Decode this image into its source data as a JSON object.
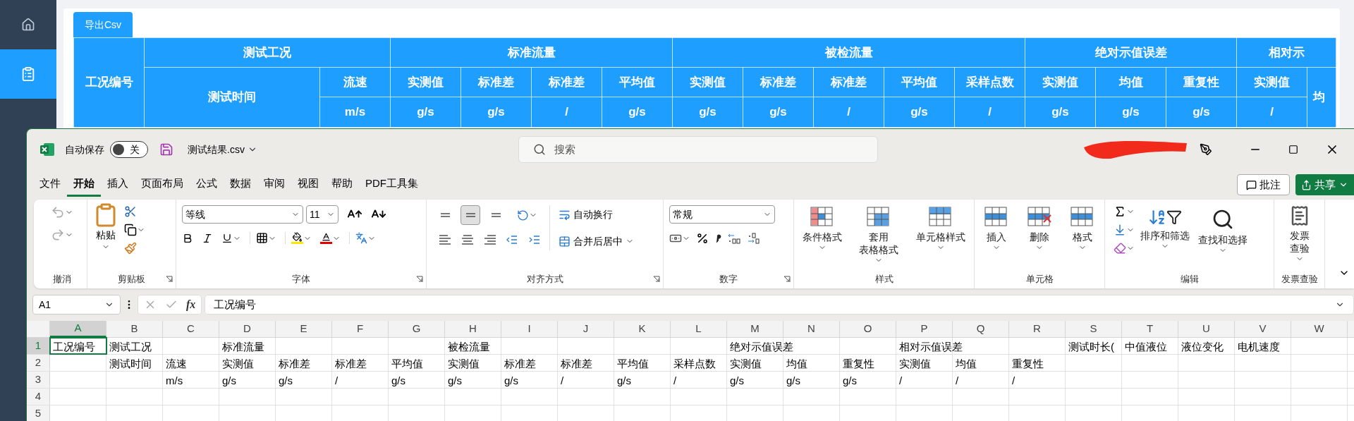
{
  "web": {
    "sidebar": {
      "items": [
        {
          "kind": "home",
          "selected": false
        },
        {
          "kind": "clipboard",
          "selected": true
        }
      ]
    },
    "export_button": "导出Csv",
    "table": {
      "id_header": "工况编号",
      "groups": [
        {
          "title": "测试工况",
          "columns": [
            {
              "label": "测试时间"
            },
            {
              "label": "流速",
              "unit": "m/s"
            }
          ]
        },
        {
          "title": "标准流量",
          "columns": [
            {
              "label": "实测值",
              "unit": "g/s"
            },
            {
              "label": "标准差",
              "unit": "g/s"
            },
            {
              "label": "标准差",
              "unit": "/"
            },
            {
              "label": "平均值",
              "unit": "g/s"
            }
          ]
        },
        {
          "title": "被检流量",
          "columns": [
            {
              "label": "实测值",
              "unit": "g/s"
            },
            {
              "label": "标准差",
              "unit": "g/s"
            },
            {
              "label": "标准差",
              "unit": "/"
            },
            {
              "label": "平均值",
              "unit": "g/s"
            },
            {
              "label": "采样点数",
              "unit": "/"
            }
          ]
        },
        {
          "title": "绝对示值误差",
          "columns": [
            {
              "label": "实测值",
              "unit": "g/s"
            },
            {
              "label": "均值",
              "unit": "g/s"
            },
            {
              "label": "重复性",
              "unit": "g/s"
            }
          ]
        },
        {
          "title": "相对示",
          "columns": [
            {
              "label": "实测值",
              "unit": "/"
            },
            {
              "label": "均"
            }
          ]
        }
      ]
    }
  },
  "excel": {
    "title_bar": {
      "autosave_label": "自动保存",
      "autosave": {
        "on": false,
        "label": "关"
      },
      "file_name": "测试结果.csv",
      "search_placeholder": "搜索"
    },
    "tabs": [
      {
        "label": "文件",
        "selected": false
      },
      {
        "label": "开始",
        "selected": true
      },
      {
        "label": "插入",
        "selected": false
      },
      {
        "label": "页面布局",
        "selected": false
      },
      {
        "label": "公式",
        "selected": false
      },
      {
        "label": "数据",
        "selected": false
      },
      {
        "label": "审阅",
        "selected": false
      },
      {
        "label": "视图",
        "selected": false
      },
      {
        "label": "帮助",
        "selected": false
      },
      {
        "label": "PDF工具集",
        "selected": false
      }
    ],
    "comments_button": "批注",
    "share_button": "共享",
    "ribbon": {
      "groups": [
        {
          "kind": "undo",
          "label": "撤消"
        },
        {
          "kind": "clipboard",
          "label": "剪贴板",
          "paste": "粘贴"
        },
        {
          "kind": "font",
          "label": "字体",
          "font_name": "等线",
          "font_size": "11"
        },
        {
          "kind": "alignment",
          "label": "对齐方式",
          "valign_buttons": [
            {
              "selected": false
            },
            {
              "selected": true
            },
            {
              "selected": false
            }
          ],
          "wrap": "自动换行",
          "merge": "合并后居中"
        },
        {
          "kind": "number",
          "label": "数字",
          "format": "常规"
        },
        {
          "kind": "styles",
          "label": "样式",
          "buttons": [
            {
              "lines": [
                "条件格式"
              ]
            },
            {
              "lines": [
                "套用",
                "表格格式"
              ]
            },
            {
              "lines": [
                "单元格样式"
              ]
            }
          ]
        },
        {
          "kind": "cells",
          "label": "单元格",
          "buttons": [
            {
              "lines": [
                "插入"
              ]
            },
            {
              "lines": [
                "删除"
              ]
            },
            {
              "lines": [
                "格式"
              ]
            }
          ]
        },
        {
          "kind": "editing",
          "label": "编辑",
          "buttons": [
            {
              "lines": [
                "排序和筛选"
              ]
            },
            {
              "lines": [
                "查找和选择"
              ]
            }
          ]
        },
        {
          "kind": "invoice",
          "label": "发票查验",
          "buttons": [
            {
              "lines": [
                "发票",
                "查验"
              ]
            }
          ]
        }
      ]
    },
    "formula_bar": {
      "name_box": "A1",
      "fx": "fx",
      "value": "工况编号"
    },
    "sheet": {
      "columns": [
        {
          "letter": "A",
          "selected": true
        },
        {
          "letter": "B",
          "selected": false
        },
        {
          "letter": "C",
          "selected": false
        },
        {
          "letter": "D",
          "selected": false
        },
        {
          "letter": "E",
          "selected": false
        },
        {
          "letter": "F",
          "selected": false
        },
        {
          "letter": "G",
          "selected": false
        },
        {
          "letter": "H",
          "selected": false
        },
        {
          "letter": "I",
          "selected": false
        },
        {
          "letter": "J",
          "selected": false
        },
        {
          "letter": "K",
          "selected": false
        },
        {
          "letter": "L",
          "selected": false
        },
        {
          "letter": "M",
          "selected": false
        },
        {
          "letter": "N",
          "selected": false
        },
        {
          "letter": "O",
          "selected": false
        },
        {
          "letter": "P",
          "selected": false
        },
        {
          "letter": "Q",
          "selected": false
        },
        {
          "letter": "R",
          "selected": false
        },
        {
          "letter": "S",
          "selected": false
        },
        {
          "letter": "T",
          "selected": false
        },
        {
          "letter": "U",
          "selected": false
        },
        {
          "letter": "V",
          "selected": false
        },
        {
          "letter": "W",
          "selected": false
        }
      ],
      "rows": [
        {
          "number": "1",
          "selected": true,
          "cells": [
            "工况编号",
            "测试工况",
            null,
            "标准流量",
            null,
            null,
            null,
            "被检流量",
            null,
            null,
            null,
            null,
            "绝对示值误差",
            null,
            null,
            "相对示值误差",
            null,
            null,
            "测试时长(",
            "中值液位",
            "液位变化",
            "电机速度",
            null
          ]
        },
        {
          "number": "2",
          "selected": false,
          "cells": [
            null,
            "测试时间",
            "流速",
            "实测值",
            "标准差",
            "标准差",
            "平均值",
            "实测值",
            "标准差",
            "标准差",
            "平均值",
            "采样点数",
            "实测值",
            "均值",
            "重复性",
            "实测值",
            "均值",
            "重复性",
            null,
            null,
            null,
            null,
            null
          ]
        },
        {
          "number": "3",
          "selected": false,
          "cells": [
            null,
            null,
            "m/s",
            "g/s",
            "g/s",
            "/",
            "g/s",
            "g/s",
            "g/s",
            "/",
            "g/s",
            "/",
            "g/s",
            "g/s",
            "g/s",
            "/",
            "/",
            "/",
            null,
            null,
            null,
            null,
            null
          ]
        },
        {
          "number": "4",
          "selected": false
        },
        {
          "number": "5",
          "selected": false
        }
      ]
    }
  }
}
